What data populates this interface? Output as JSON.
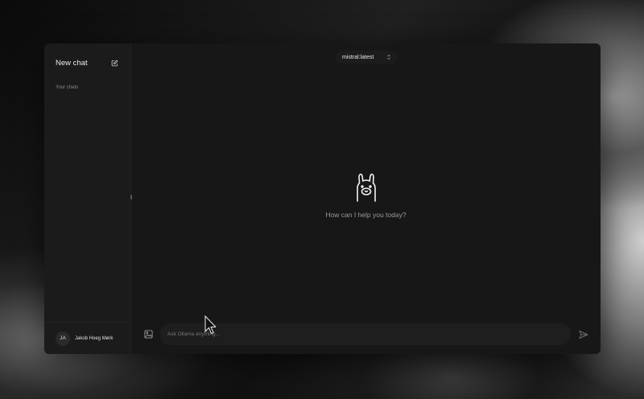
{
  "sidebar": {
    "title": "New chat",
    "section_label": "Your chats",
    "user": {
      "initials": "JA",
      "name": "Jakob Hoeg Mørk"
    }
  },
  "header": {
    "model": "mistral:latest"
  },
  "main": {
    "help_text": "How can I help you today?"
  },
  "composer": {
    "placeholder": "Ask Ollama anything..."
  },
  "icons": {
    "edit": "edit-icon",
    "model_toggle": "chevron-updown-icon",
    "logo": "llama-icon",
    "image": "image-icon",
    "send": "send-icon"
  },
  "colors": {
    "window_bg": "#171717",
    "sidebar_bg": "#1b1b1b",
    "text": "#ececec",
    "muted": "#9a9a9a"
  }
}
